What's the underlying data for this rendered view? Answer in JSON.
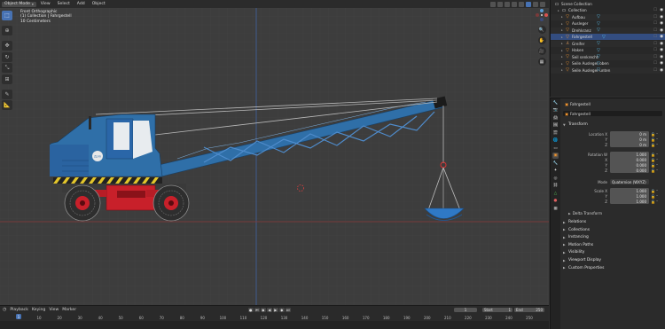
{
  "viewport": {
    "header": {
      "mode": "Object Mode",
      "menus": [
        "View",
        "Select",
        "Add",
        "Object"
      ]
    },
    "info": {
      "line1": "Front Orthographic",
      "line2": "(1) Collection | Fahrgestell",
      "line3": "10 Centimeters"
    },
    "tools": [
      "select-box-icon",
      "cursor-icon",
      "move-icon",
      "rotate-icon",
      "scale-icon",
      "transform-icon",
      "annotate-icon",
      "measure-icon"
    ],
    "badge_text": "Zpm"
  },
  "timeline": {
    "menus": [
      "Playback",
      "Keying",
      "View",
      "Marker"
    ],
    "current_frame": "1",
    "start_label": "Start",
    "start_value": "1",
    "end_label": "End",
    "end_value": "250",
    "ruler": [
      "1",
      "10",
      "20",
      "30",
      "40",
      "50",
      "60",
      "70",
      "80",
      "90",
      "100",
      "110",
      "120",
      "130",
      "140",
      "150",
      "160",
      "170",
      "180",
      "190",
      "200",
      "210",
      "220",
      "230",
      "240",
      "250"
    ]
  },
  "outliner": {
    "title": "Scene Collection",
    "items": [
      {
        "label": "Collection",
        "type": "collection"
      },
      {
        "label": "Aufbau",
        "type": "object"
      },
      {
        "label": "Ausleger",
        "type": "object"
      },
      {
        "label": "Drehkranz",
        "type": "object"
      },
      {
        "label": "Fahrgestell",
        "type": "object",
        "selected": true
      },
      {
        "label": "Greifer",
        "type": "bone"
      },
      {
        "label": "Haken",
        "type": "object"
      },
      {
        "label": "Seil senkrecht",
        "type": "object"
      },
      {
        "label": "Seile Ausleger oben",
        "type": "object"
      },
      {
        "label": "Seile Ausleger unten",
        "type": "object"
      }
    ]
  },
  "properties": {
    "object_name": "Fahrgestell",
    "object_name_field": "Fahrgestell",
    "transform_label": "Transform",
    "location": {
      "label": "Location X",
      "x": "0 m",
      "y": "0 m",
      "z": "0 m"
    },
    "rotation": {
      "label": "Rotation W",
      "w": "1.000",
      "x": "0.000",
      "y": "0.000",
      "z": "0.000"
    },
    "mode": {
      "label": "Mode",
      "value": "Quaternion (WXYZ)"
    },
    "scale": {
      "label": "Scale X",
      "x": "1.000",
      "y": "1.000",
      "z": "1.000"
    },
    "axis_labels": {
      "y": "Y",
      "z": "Z",
      "x": "X"
    },
    "delta_transform": "Delta Transform",
    "panels": [
      "Relations",
      "Collections",
      "Instancing",
      "Motion Paths",
      "Visibility",
      "Viewport Display",
      "Custom Properties"
    ]
  },
  "colors": {
    "accent": "#4772b3",
    "crane_blue": "#2f6fa8",
    "chassis_red": "#c8202a",
    "selection": "#334d80"
  }
}
